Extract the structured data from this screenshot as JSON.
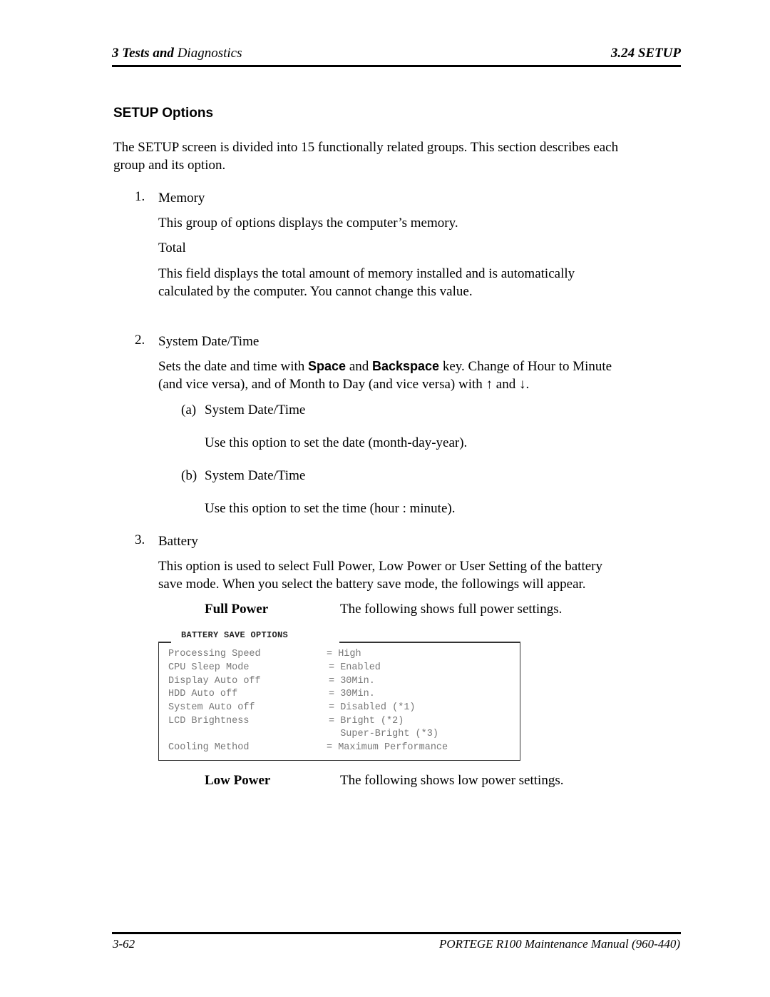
{
  "header": {
    "chapter_num": "3",
    "chapter_bold": "Tests and",
    "chapter_rest": "Diagnostics",
    "section": "3.24  SETUP"
  },
  "section_title": "SETUP Options",
  "intro": {
    "line1": "The SETUP screen is divided into 15 functionally related groups. This section describes each",
    "line2": "group and its option."
  },
  "items": [
    {
      "num": "1.",
      "title": "Memory",
      "desc": "This group of options displays the computer’s memory.",
      "sub_title": "Total",
      "sub_line1": "This field displays the total amount of memory installed and is automatically",
      "sub_line2": "calculated by the computer. You cannot change this value."
    },
    {
      "num": "2.",
      "title": "System Date/Time",
      "desc_pre": "Sets the date and time with ",
      "key1": "Space",
      "desc_mid": " and ",
      "key2": "Backspace",
      "desc_post": " key. Change of Hour to Minute",
      "desc_line2": "(and vice versa), and of Month to Day (and vice versa) with ↑ and ↓.",
      "subs": [
        {
          "label": "(a)",
          "title": "System Date/Time",
          "desc": "Use this option to set the date (month-day-year)."
        },
        {
          "label": "(b)",
          "title": "System Date/Time",
          "desc": "Use this option to set the time (hour : minute)."
        }
      ]
    },
    {
      "num": "3.",
      "title": "Battery",
      "desc_line1": "This option is used to select Full Power, Low Power or User Setting of the battery",
      "desc_line2": "save mode. When you select the battery save mode, the followings will appear.",
      "full_power_label": "Full Power",
      "full_power_desc": "The following shows full power settings.",
      "low_power_label": "Low Power",
      "low_power_desc": "The following shows low power settings."
    }
  ],
  "battery_box": {
    "title": "BATTERY SAVE OPTIONS",
    "rows": [
      {
        "key": "Processing Speed",
        "value": "= High"
      },
      {
        "key": "CPU Sleep Mode",
        "value": "= Enabled"
      },
      {
        "key": "Display Auto off",
        "value": "= 30Min."
      },
      {
        "key": "HDD Auto off",
        "value": "= 30Min."
      },
      {
        "key": "System Auto off",
        "value": "= Disabled (*1)"
      },
      {
        "key": "LCD Brightness",
        "value": "= Bright (*2)"
      },
      {
        "key": "",
        "value": "  Super-Bright (*3)"
      },
      {
        "key": "Cooling Method",
        "value": "= Maximum Performance"
      }
    ]
  },
  "footer": {
    "page": "3-62",
    "manual": "PORTEGE R100 Maintenance Manual (960-440)"
  }
}
